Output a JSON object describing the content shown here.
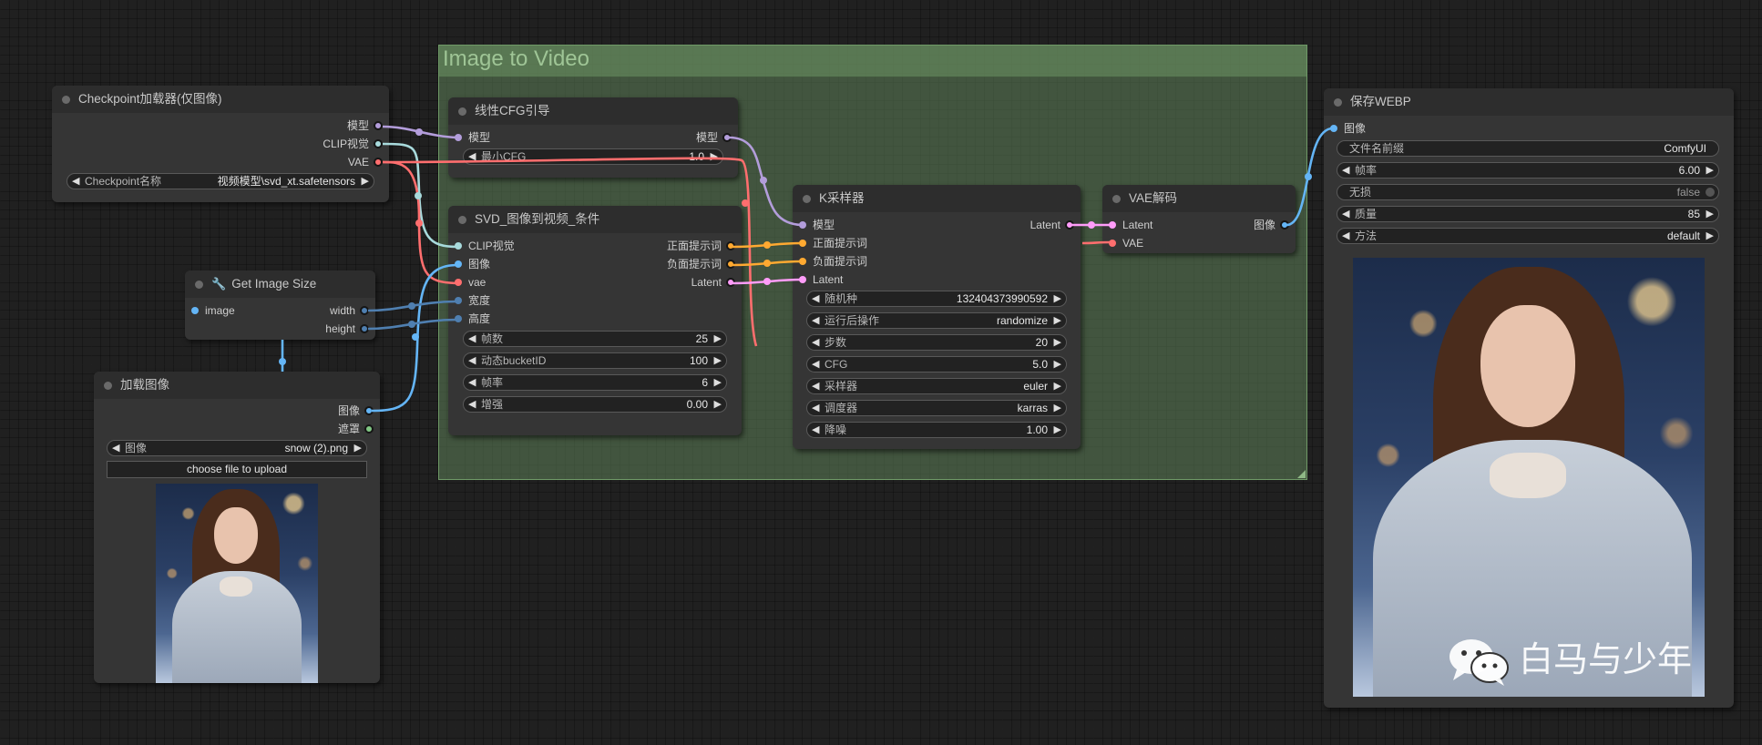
{
  "group": {
    "title": "Image to Video"
  },
  "nodes": {
    "checkpoint": {
      "title": "Checkpoint加载器(仅图像)",
      "outputs": [
        "模型",
        "CLIP视觉",
        "VAE"
      ],
      "widgets": [
        {
          "label": "Checkpoint名称",
          "value": "视频模型\\svd_xt.safetensors"
        }
      ]
    },
    "get_image_size": {
      "title": "Get Image Size",
      "inputs": [
        "image"
      ],
      "outputs": [
        "width",
        "height"
      ]
    },
    "load_image": {
      "title": "加载图像",
      "outputs": [
        "图像",
        "遮罩"
      ],
      "widgets": [
        {
          "label": "图像",
          "value": "snow (2).png"
        }
      ],
      "upload_label": "choose file to upload"
    },
    "linear_cfg": {
      "title": "线性CFG引导",
      "inputs": [
        "模型"
      ],
      "outputs": [
        "模型"
      ],
      "widgets": [
        {
          "label": "最小CFG",
          "value": "1.0"
        }
      ]
    },
    "svd_cond": {
      "title": "SVD_图像到视频_条件",
      "inputs": [
        "CLIP视觉",
        "图像",
        "vae",
        "宽度",
        "高度"
      ],
      "outputs": [
        "正面提示词",
        "负面提示词",
        "Latent"
      ],
      "widgets": [
        {
          "label": "帧数",
          "value": "25"
        },
        {
          "label": "动态bucketID",
          "value": "100"
        },
        {
          "label": "帧率",
          "value": "6"
        },
        {
          "label": "增强",
          "value": "0.00"
        }
      ]
    },
    "ksampler": {
      "title": "K采样器",
      "inputs": [
        "模型",
        "正面提示词",
        "负面提示词",
        "Latent"
      ],
      "outputs": [
        "Latent"
      ],
      "widgets": [
        {
          "label": "随机种",
          "value": "132404373990592"
        },
        {
          "label": "运行后操作",
          "value": "randomize"
        },
        {
          "label": "步数",
          "value": "20"
        },
        {
          "label": "CFG",
          "value": "5.0"
        },
        {
          "label": "采样器",
          "value": "euler"
        },
        {
          "label": "调度器",
          "value": "karras"
        },
        {
          "label": "降噪",
          "value": "1.00"
        }
      ]
    },
    "vae_decode": {
      "title": "VAE解码",
      "inputs": [
        "Latent",
        "VAE"
      ],
      "outputs": [
        "图像"
      ]
    },
    "save_webp": {
      "title": "保存WEBP",
      "inputs": [
        "图像"
      ],
      "widgets": [
        {
          "label": "文件名前缀",
          "value": "ComfyUI",
          "arrows": false
        },
        {
          "label": "帧率",
          "value": "6.00",
          "arrows": true
        },
        {
          "label": "无损",
          "value": "false",
          "toggle": true
        },
        {
          "label": "质量",
          "value": "85",
          "arrows": true
        },
        {
          "label": "方法",
          "value": "default",
          "arrows": true
        }
      ],
      "watermark": "白马与少年"
    }
  },
  "colors": {
    "model": "#b39ddb",
    "clip_vision": "#a8dadc",
    "vae": "#ff6e6e",
    "image": "#64b5f6",
    "int": "#4f7fb0",
    "conditioning": "#ffa931",
    "latent": "#ff9cf9",
    "mask": "#81c784",
    "group_title": "#9fc596"
  }
}
